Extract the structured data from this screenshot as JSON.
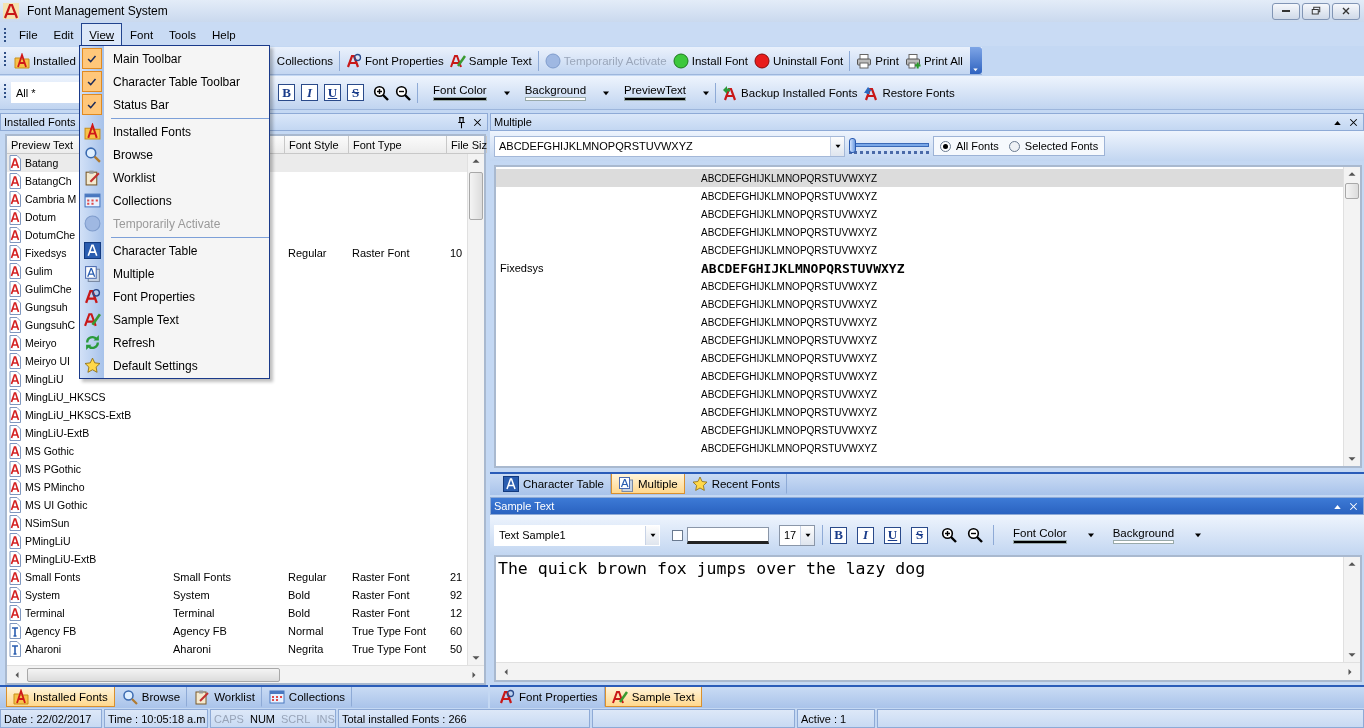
{
  "window": {
    "title": "Font Management System"
  },
  "menu_bar": [
    {
      "label": "File",
      "selected": false
    },
    {
      "label": "Edit",
      "selected": false
    },
    {
      "label": "View",
      "selected": true
    },
    {
      "label": "Font",
      "selected": false
    },
    {
      "label": "Tools",
      "selected": false
    },
    {
      "label": "Help",
      "selected": false
    }
  ],
  "view_menu": {
    "groups": [
      [
        {
          "kind": "check",
          "label": "Main Toolbar",
          "checked": true
        },
        {
          "kind": "check",
          "label": "Character Table Toolbar",
          "checked": true
        },
        {
          "kind": "check",
          "label": "Status Bar",
          "checked": true
        }
      ],
      [
        {
          "kind": "command",
          "label": "Installed Fonts",
          "disabled": false
        },
        {
          "kind": "command",
          "label": "Browse",
          "disabled": false
        },
        {
          "kind": "command",
          "label": "Worklist",
          "disabled": false
        },
        {
          "kind": "command",
          "label": "Collections",
          "disabled": false
        },
        {
          "kind": "command",
          "label": "Temporarily Activate",
          "disabled": true
        }
      ],
      [
        {
          "kind": "command",
          "label": "Character Table",
          "disabled": false
        },
        {
          "kind": "command",
          "label": "Multiple",
          "disabled": false
        },
        {
          "kind": "command",
          "label": "Font Properties",
          "disabled": false
        },
        {
          "kind": "command",
          "label": "Sample Text",
          "disabled": false
        },
        {
          "kind": "command",
          "label": "Refresh",
          "disabled": false
        },
        {
          "kind": "command",
          "label": "Default Settings",
          "disabled": false
        }
      ]
    ]
  },
  "main_toolbar": [
    {
      "label": "Installed",
      "disabled": false
    },
    {
      "label": "Collections",
      "disabled": false
    },
    {
      "label": "Font Properties",
      "disabled": false
    },
    {
      "label": "Sample Text",
      "disabled": false
    },
    {
      "label": "Temporarily Activate",
      "disabled": true
    },
    {
      "label": "Install Font",
      "disabled": false
    },
    {
      "label": "Uninstall Font",
      "disabled": false
    },
    {
      "label": "Print",
      "disabled": false
    },
    {
      "label": "Print All",
      "disabled": false
    }
  ],
  "format_toolbar": {
    "filter": "All *",
    "style_buttons": [
      "B",
      "I",
      "U",
      "S"
    ],
    "color_pickers": [
      {
        "label": "Font Color",
        "color": "#000000"
      },
      {
        "label": "Background",
        "color": "#ffffff"
      },
      {
        "label": "PreviewText",
        "color": "#000000"
      }
    ],
    "actions": [
      "Backup Installed Fonts",
      "Restore Fonts"
    ]
  },
  "installed_fonts_panel": {
    "title": "Installed Fonts",
    "active": false,
    "columns": [
      "Preview Text",
      "Font Style",
      "Font Type",
      "File Siz"
    ],
    "rows": [
      {
        "kind": "font",
        "preview": "Batang",
        "selected": true
      },
      {
        "kind": "font",
        "preview": "BatangCh",
        "selected": false
      },
      {
        "kind": "font",
        "preview": "Cambria M",
        "selected": false
      },
      {
        "kind": "font",
        "preview": "Dotum",
        "selected": false
      },
      {
        "kind": "font",
        "preview": "DotumChe",
        "selected": false
      },
      {
        "kind": "font",
        "preview": "Fixedsys",
        "font_style": "Regular",
        "font_type": "Raster Font",
        "file_size": "10",
        "selected": false
      },
      {
        "kind": "font",
        "preview": "Gulim",
        "selected": false
      },
      {
        "kind": "font",
        "preview": "GulimChe",
        "selected": false
      },
      {
        "kind": "font",
        "preview": "Gungsuh",
        "selected": false
      },
      {
        "kind": "font",
        "preview": "GungsuhC",
        "selected": false
      },
      {
        "kind": "font",
        "preview": "Meiryo",
        "selected": false
      },
      {
        "kind": "font",
        "preview": "Meiryo UI",
        "selected": false
      },
      {
        "kind": "font",
        "preview": "MingLiU",
        "selected": false
      },
      {
        "kind": "font",
        "preview": "MingLiU_HKSCS",
        "selected": false
      },
      {
        "kind": "font",
        "preview": "MingLiU_HKSCS-ExtB",
        "selected": false
      },
      {
        "kind": "font",
        "preview": "MingLiU-ExtB",
        "selected": false
      },
      {
        "kind": "font",
        "preview": "MS Gothic",
        "selected": false
      },
      {
        "kind": "font",
        "preview": "MS PGothic",
        "selected": false
      },
      {
        "kind": "font",
        "preview": "MS PMincho",
        "selected": false
      },
      {
        "kind": "font",
        "preview": "MS UI Gothic",
        "selected": false
      },
      {
        "kind": "font",
        "preview": "NSimSun",
        "selected": false
      },
      {
        "kind": "font",
        "preview": "PMingLiU",
        "selected": false
      },
      {
        "kind": "font",
        "preview": "PMingLiU-ExtB",
        "selected": false
      },
      {
        "kind": "font",
        "preview": "Small Fonts",
        "column_2": "Small Fonts",
        "font_style": "Regular",
        "font_type": "Raster Font",
        "file_size": "21",
        "selected": false
      },
      {
        "kind": "font",
        "preview": "System",
        "column_2": "System",
        "font_style": "Bold",
        "font_type": "Raster Font",
        "file_size": "92",
        "selected": false
      },
      {
        "kind": "font",
        "preview": "Terminal",
        "column_2": "Terminal",
        "font_style": "Bold",
        "font_type": "Raster Font",
        "file_size": "12",
        "selected": false
      },
      {
        "kind": "truetype",
        "preview": "Agency FB",
        "column_2": "Agency FB",
        "font_style": "Normal",
        "font_type": "True Type Font",
        "file_size": "60",
        "selected": false
      },
      {
        "kind": "truetype",
        "preview": "Aharoni",
        "column_2": "Aharoni",
        "font_style": "Negrita",
        "font_type": "True Type Font",
        "file_size": "50",
        "selected": false
      }
    ],
    "tabs": [
      {
        "label": "Installed Fonts",
        "selected": true
      },
      {
        "label": "Browse",
        "selected": false
      },
      {
        "label": "Worklist",
        "selected": false
      },
      {
        "label": "Collections",
        "selected": false
      }
    ]
  },
  "multiple_panel": {
    "title": "Multiple",
    "active": false,
    "preview_text": "ABCDEFGHIJKLMNOPQRSTUVWXYZ",
    "size_slider": {
      "level": 0
    },
    "scope": [
      {
        "label": "All Fonts",
        "selected": true
      },
      {
        "label": "Selected Fonts",
        "selected": false
      }
    ],
    "rows": [
      {
        "kind": "plain",
        "sample": "ABCDEFGHIJKLMNOPQRSTUVWXYZ",
        "selected": true
      },
      {
        "kind": "plain",
        "sample": "ABCDEFGHIJKLMNOPQRSTUVWXYZ",
        "selected": false
      },
      {
        "kind": "plain",
        "sample": "ABCDEFGHIJKLMNOPQRSTUVWXYZ",
        "selected": false
      },
      {
        "kind": "plain",
        "sample": "ABCDEFGHIJKLMNOPQRSTUVWXYZ",
        "selected": false
      },
      {
        "kind": "plain",
        "sample": "ABCDEFGHIJKLMNOPQRSTUVWXYZ",
        "selected": false
      },
      {
        "kind": "raster",
        "font": "Fixedsys",
        "sample": "ABCDEFGHIJKLMNOPQRSTUVWXYZ",
        "selected": false
      },
      {
        "kind": "plain",
        "sample": "ABCDEFGHIJKLMNOPQRSTUVWXYZ",
        "selected": false
      },
      {
        "kind": "plain",
        "sample": "ABCDEFGHIJKLMNOPQRSTUVWXYZ",
        "selected": false
      },
      {
        "kind": "plain",
        "sample": "ABCDEFGHIJKLMNOPQRSTUVWXYZ",
        "selected": false
      },
      {
        "kind": "plain",
        "sample": "ABCDEFGHIJKLMNOPQRSTUVWXYZ",
        "selected": false
      },
      {
        "kind": "plain",
        "sample": "ABCDEFGHIJKLMNOPQRSTUVWXYZ",
        "selected": false
      },
      {
        "kind": "plain",
        "sample": "ABCDEFGHIJKLMNOPQRSTUVWXYZ",
        "selected": false
      },
      {
        "kind": "plain",
        "sample": "ABCDEFGHIJKLMNOPQRSTUVWXYZ",
        "selected": false
      },
      {
        "kind": "plain",
        "sample": "ABCDEFGHIJKLMNOPQRSTUVWXYZ",
        "selected": false
      },
      {
        "kind": "plain",
        "sample": "ABCDEFGHIJKLMNOPQRSTUVWXYZ",
        "selected": false
      },
      {
        "kind": "plain",
        "sample": "ABCDEFGHIJKLMNOPQRSTUVWXYZ",
        "selected": false
      }
    ],
    "tabs": [
      {
        "label": "Character Table",
        "selected": false
      },
      {
        "label": "Multiple",
        "selected": true
      },
      {
        "label": "Recent Fonts",
        "selected": false
      }
    ]
  },
  "sample_text_panel": {
    "title": "Sample Text",
    "active": true,
    "sample": "Text Sample1",
    "checkbox": {
      "checked": false
    },
    "size": "17",
    "style_buttons": [
      "B",
      "I",
      "U",
      "S"
    ],
    "color_pickers": [
      {
        "label": "Font Color",
        "color": "#000000"
      },
      {
        "label": "Background",
        "color": "#ffffff"
      }
    ],
    "text": "The quick brown fox jumps over the lazy dog",
    "tabs": [
      {
        "label": "Font Properties",
        "selected": false
      },
      {
        "label": "Sample Text",
        "selected": true
      }
    ]
  },
  "status_bar": {
    "date": "Date : 22/02/2017",
    "time": "Time : 10:05:18 a.m",
    "keys": [
      {
        "label": "CAPS",
        "on": false
      },
      {
        "label": "NUM",
        "on": true
      },
      {
        "label": "SCRL",
        "on": false
      },
      {
        "label": "INS",
        "on": false
      }
    ],
    "total": "Total installed Fonts : 266",
    "active": "Active : 1"
  }
}
